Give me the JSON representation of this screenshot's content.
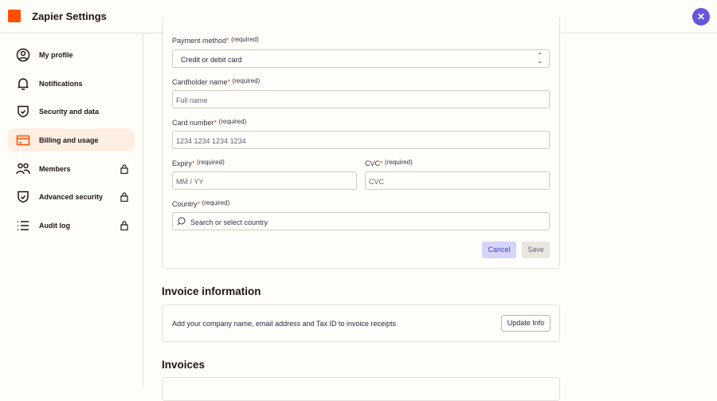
{
  "header": {
    "title": "Zapier Settings",
    "close_icon": "close-icon"
  },
  "sidebar": {
    "items": [
      {
        "label": "My profile",
        "icon": "user-circle-icon",
        "locked": false
      },
      {
        "label": "Notifications",
        "icon": "bell-icon",
        "locked": false
      },
      {
        "label": "Security and data",
        "icon": "shield-check-icon",
        "locked": false
      },
      {
        "label": "Billing and usage",
        "icon": "credit-card-icon",
        "locked": false,
        "active": true
      },
      {
        "label": "Members",
        "icon": "users-icon",
        "locked": true
      },
      {
        "label": "Advanced security",
        "icon": "shield-check-icon",
        "locked": true
      },
      {
        "label": "Audit log",
        "icon": "list-icon",
        "locked": true
      }
    ]
  },
  "form": {
    "required_text": "(required)",
    "star": "*",
    "payment_method": {
      "label": "Payment method",
      "value": "Credit or debit card"
    },
    "cardholder": {
      "label": "Cardholder name",
      "placeholder": "Full name"
    },
    "card_number": {
      "label": "Card number",
      "placeholder": "1234 1234 1234 1234"
    },
    "expiry": {
      "label": "Expiry",
      "placeholder": "MM / YY"
    },
    "cvc": {
      "label": "CVC",
      "placeholder": "CVC"
    },
    "country": {
      "label": "Country",
      "placeholder": "Search or select country"
    },
    "cancel": "Cancel",
    "save": "Save"
  },
  "invoice_info": {
    "heading": "Invoice information",
    "text": "Add your company name, email address and Tax ID to invoice receipts",
    "button": "Update Info"
  },
  "invoices": {
    "heading": "Invoices"
  },
  "colors": {
    "accent": "#6557dc",
    "brand": "#ff4f00",
    "active_bg": "#fdefe2"
  }
}
